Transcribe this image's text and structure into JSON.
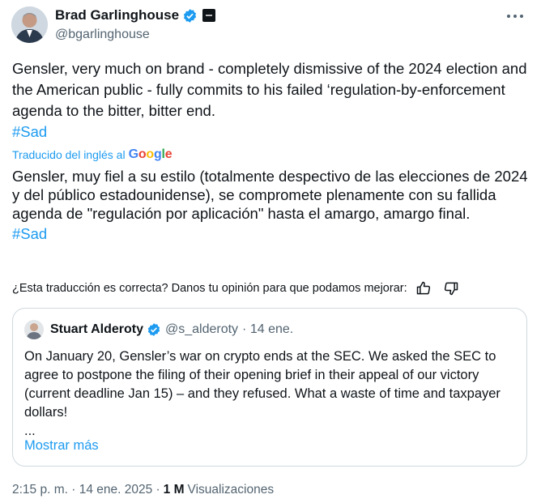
{
  "author": {
    "name": "Brad Garlinghouse",
    "handle": "@bgarlinghouse"
  },
  "tweet": {
    "text": "Gensler, very much on brand - completely dismissive of the 2024 election and the American public - fully commits to his failed ‘regulation-by-enforcement agenda to the bitter, bitter end.",
    "hashtag": "#Sad"
  },
  "translation": {
    "label": "Traducido del inglés al",
    "provider": [
      "G",
      "o",
      "o",
      "g",
      "l",
      "e"
    ],
    "text": "Gensler, muy fiel a su estilo (totalmente despectivo de las elecciones de 2024 y del público estadounidense), se compromete plenamente con su fallida agenda de \"regulación por aplicación\" hasta el amargo, amargo final.",
    "hashtag": "#Sad",
    "feedback_prompt": "¿Esta traducción es correcta? Danos tu opinión para que podamos mejorar:"
  },
  "quote": {
    "name": "Stuart Alderoty",
    "handle": "@s_alderoty",
    "date": "· 14 ene.",
    "text": "On January 20, Gensler’s war on crypto ends at the SEC. We asked the SEC to agree to postpone the filing of their opening brief in their appeal of our victory (current deadline Jan 15) – and they refused. What a waste of time and taxpayer dollars!",
    "ellipsis": "...",
    "show_more": "Mostrar más"
  },
  "stats": {
    "timestamp": "2:15 p. m. · 14 ene. 2025 ·",
    "views": "1 M",
    "views_label": "Visualizaciones"
  },
  "icons": {
    "verified": "verified-badge-icon",
    "affiliation": "affiliation-icon",
    "more": "more-icon",
    "thumbs_up": "thumbs-up-icon",
    "thumbs_down": "thumbs-down-icon"
  },
  "colors": {
    "accent": "#1d9bf0",
    "text": "#0f1419",
    "muted": "#536471",
    "border": "#cfd9de"
  }
}
